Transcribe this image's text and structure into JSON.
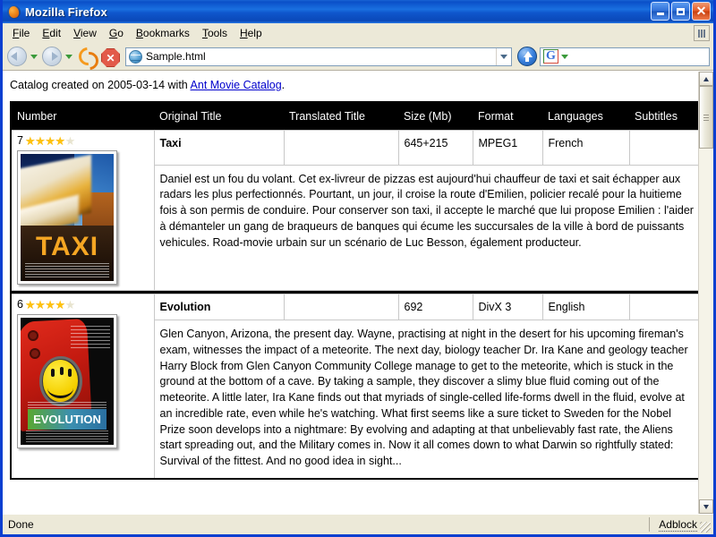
{
  "window": {
    "title": "Mozilla Firefox",
    "app_icon": "firefox-icon",
    "minimize_label": "Minimize",
    "maximize_label": "Maximize",
    "close_label": "Close"
  },
  "menubar": {
    "items": [
      {
        "label": "File",
        "accel": "F"
      },
      {
        "label": "Edit",
        "accel": "E"
      },
      {
        "label": "View",
        "accel": "V"
      },
      {
        "label": "Go",
        "accel": "G"
      },
      {
        "label": "Bookmarks",
        "accel": "B"
      },
      {
        "label": "Tools",
        "accel": "T"
      },
      {
        "label": "Help",
        "accel": "H"
      }
    ]
  },
  "toolbar": {
    "back_label": "Back",
    "forward_label": "Forward",
    "reload_label": "Reload",
    "stop_label": "Stop",
    "stop_glyph": "✕",
    "url_value": "Sample.html",
    "url_placeholder": "",
    "go_label": "Go",
    "search_value": "",
    "search_placeholder": "",
    "search_engine_letter": "G"
  },
  "page": {
    "intro_prefix": "Catalog created on 2005-03-14 with ",
    "intro_link": "Ant Movie Catalog",
    "intro_suffix": ".",
    "columns": [
      "Number",
      "Original Title",
      "Translated Title",
      "Size (Mb)",
      "Format",
      "Languages",
      "Subtitles"
    ],
    "movies": [
      {
        "number": "7",
        "rating_filled": 4,
        "rating_total": 5,
        "original_title": "Taxi",
        "translated_title": "",
        "size": "645+215",
        "format": "MPEG1",
        "languages": "French",
        "subtitles": "",
        "poster_alt": "taxi-poster",
        "poster_word": "TAXI",
        "description": "Daniel est un fou du volant. Cet ex-livreur de pizzas est aujourd'hui chauffeur de taxi et sait échapper aux radars les plus perfectionnés. Pourtant, un jour, il croise la route d'Emilien, policier recalé pour la huitieme fois à son permis de conduire. Pour conserver son taxi, il accepte le marché que lui propose Emilien : l'aider à démanteler un gang de braqueurs de banques qui écume les succursales de la ville à bord de puissants vehicules. Road-movie urbain sur un scénario de Luc Besson, également producteur."
      },
      {
        "number": "6",
        "rating_filled": 4,
        "rating_total": 5,
        "original_title": "Evolution",
        "translated_title": "",
        "size": "692",
        "format": "DivX 3",
        "languages": "English",
        "subtitles": "",
        "poster_alt": "evolution-poster",
        "poster_word": "EVOLUTION",
        "description": "Glen Canyon, Arizona, the present day. Wayne, practising at night in the desert for his upcoming fireman's exam, witnesses the impact of a meteorite. The next day, biology teacher Dr. Ira Kane and geology teacher Harry Block from Glen Canyon Community College manage to get to the meteorite, which is stuck in the ground at the bottom of a cave. By taking a sample, they discover a slimy blue fluid coming out of the meteorite. A little later, Ira Kane finds out that myriads of single-celled life-forms dwell in the fluid, evolve at an incredible rate, even while he's watching. What first seems like a sure ticket to Sweden for the Nobel Prize soon develops into a nightmare: By evolving and adapting at that unbelievably fast rate, the Aliens start spreading out, and the Military comes in. Now it all comes down to what Darwin so rightfully stated: Survival of the fittest. And no good idea in sight..."
      }
    ]
  },
  "statusbar": {
    "status": "Done",
    "adblock": "Adblock"
  },
  "colors": {
    "titlebar_blue": "#0a4fc8",
    "header_black": "#000000",
    "link_blue": "#0000cc",
    "star_gold": "#ffc20e",
    "star_empty": "#e8e4cf",
    "chrome_beige": "#ece9d8"
  }
}
